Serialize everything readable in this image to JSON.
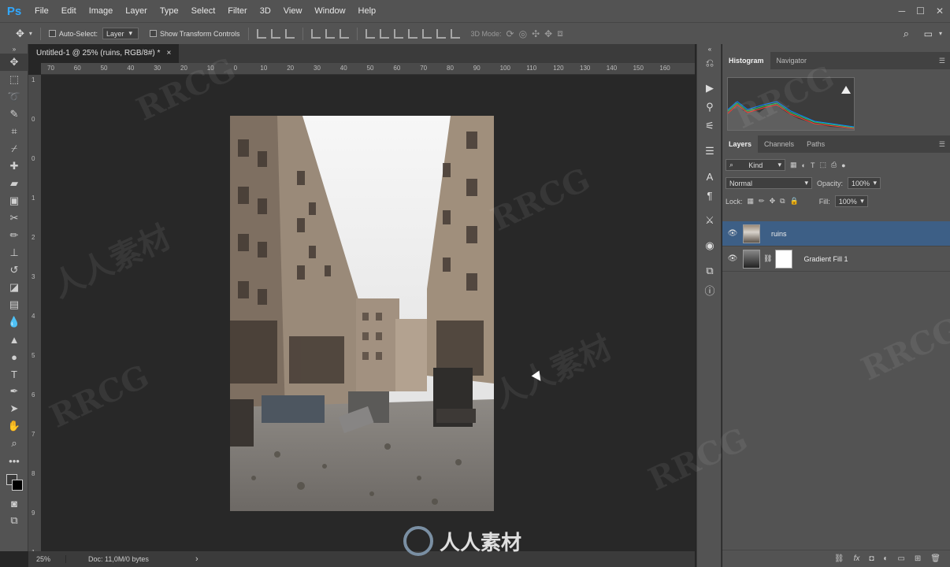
{
  "app": {
    "logo": "Ps",
    "menu": [
      "File",
      "Edit",
      "Image",
      "Layer",
      "Type",
      "Select",
      "Filter",
      "3D",
      "View",
      "Window",
      "Help"
    ],
    "window_controls": [
      "minimize-icon",
      "maximize-icon",
      "close-icon"
    ]
  },
  "options_bar": {
    "auto_select_label": "Auto-Select:",
    "auto_select_value": "Layer",
    "show_transform_label": "Show Transform Controls",
    "mode_3d_label": "3D Mode:"
  },
  "document": {
    "tab_title": "Untitled-1 @ 25% (ruins, RGB/8#) *",
    "tab_close": "×",
    "ruler_top_labels": [
      "70",
      "60",
      "50",
      "40",
      "30",
      "20",
      "10",
      "0",
      "10",
      "20",
      "30",
      "40",
      "50",
      "60",
      "70",
      "80",
      "90",
      "100",
      "110",
      "120",
      "130",
      "140",
      "150",
      "160"
    ],
    "ruler_left_labels": [
      "1",
      "0",
      "0",
      "1",
      "2",
      "3",
      "4",
      "5",
      "6",
      "7",
      "8",
      "9",
      "1"
    ]
  },
  "status": {
    "zoom": "25%",
    "doc_info": "Doc: 11,0M/0 bytes",
    "arrow": "›"
  },
  "panels": {
    "top_tabs": [
      "Histogram",
      "Navigator"
    ],
    "layers_tabs": [
      "Layers",
      "Channels",
      "Paths"
    ],
    "kind_label": "Kind",
    "blend_mode": "Normal",
    "opacity_label": "Opacity:",
    "opacity_value": "100%",
    "lock_label": "Lock:",
    "fill_label": "Fill:",
    "fill_value": "100%",
    "layers": [
      {
        "name": "ruins",
        "selected": true
      },
      {
        "name": "Gradient Fill 1",
        "selected": false
      }
    ]
  },
  "watermarks": {
    "text": "RRCG",
    "brand": "人人素材"
  },
  "colors": {
    "ps_blue": "#31a8ff",
    "selection": "#3d5f86",
    "panel_bg": "#535353",
    "canvas_bg": "#282828"
  }
}
